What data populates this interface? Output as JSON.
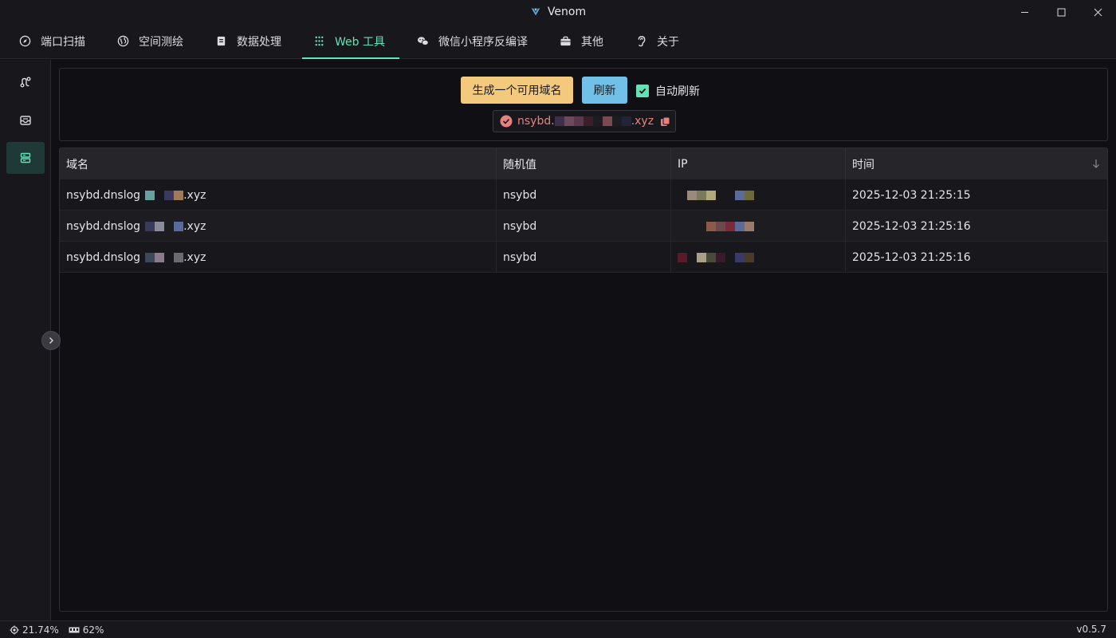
{
  "window": {
    "title": "Venom"
  },
  "menu": [
    {
      "label": "端口扫描",
      "icon": "compass-icon"
    },
    {
      "label": "空间测绘",
      "icon": "globe-icon"
    },
    {
      "label": "数据处理",
      "icon": "document-icon"
    },
    {
      "label": "Web 工具",
      "icon": "grid-dots-icon",
      "active": true
    },
    {
      "label": "微信小程序反编译",
      "icon": "wechat-icon"
    },
    {
      "label": "其他",
      "icon": "briefcase-icon"
    },
    {
      "label": "关于",
      "icon": "ear-icon"
    }
  ],
  "sidebar": [
    {
      "icon": "route-icon"
    },
    {
      "icon": "inbox-icon"
    },
    {
      "icon": "server-icon",
      "active": true
    }
  ],
  "toolbar": {
    "generate_label": "生成一个可用域名",
    "refresh_label": "刷新",
    "auto_refresh_label": "自动刷新",
    "auto_refresh_checked": true
  },
  "current_domain": {
    "prefix": "nsybd.",
    "suffix": ".xyz",
    "status_color": "#e88080"
  },
  "table": {
    "columns": [
      "域名",
      "随机值",
      "IP",
      "时间"
    ],
    "rows": [
      {
        "domain_prefix": "nsybd.dnslog",
        "domain_suffix": ".xyz",
        "random": "nsybd",
        "time": "2025-12-03 21:25:15"
      },
      {
        "domain_prefix": "nsybd.dnslog",
        "domain_suffix": ".xyz",
        "random": "nsybd",
        "time": "2025-12-03 21:25:16"
      },
      {
        "domain_prefix": "nsybd.dnslog",
        "domain_suffix": ".xyz",
        "random": "nsybd",
        "time": "2025-12-03 21:25:16"
      }
    ]
  },
  "status": {
    "cpu": "21.74%",
    "memory": "62%",
    "version": "v0.5.7"
  },
  "colors": {
    "accent": "#63e2b7",
    "warning": "#f2c97d",
    "info": "#70c0e8",
    "error": "#e88080"
  }
}
